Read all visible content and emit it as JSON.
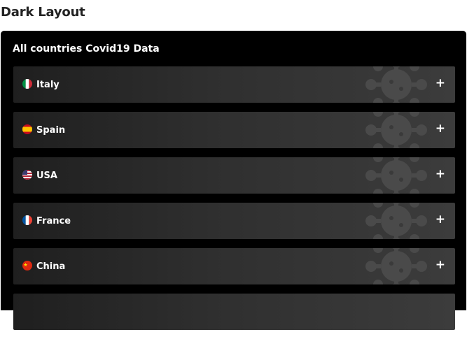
{
  "page": {
    "title": "Dark Layout"
  },
  "panel": {
    "title": "All countries Covid19 Data",
    "countries": [
      {
        "name": "Italy",
        "flag_icon": "italy-flag-icon",
        "expand_icon": "+"
      },
      {
        "name": "Spain",
        "flag_icon": "spain-flag-icon",
        "expand_icon": "+"
      },
      {
        "name": "USA",
        "flag_icon": "usa-flag-icon",
        "expand_icon": "+"
      },
      {
        "name": "France",
        "flag_icon": "france-flag-icon",
        "expand_icon": "+"
      },
      {
        "name": "China",
        "flag_icon": "china-flag-icon",
        "expand_icon": "+"
      }
    ]
  },
  "colors": {
    "panel_bg": "#000000",
    "row_gradient_start": "#1f1f1f",
    "row_gradient_end": "#3c3c3c",
    "virus_decoration": "#4a4a4a"
  }
}
